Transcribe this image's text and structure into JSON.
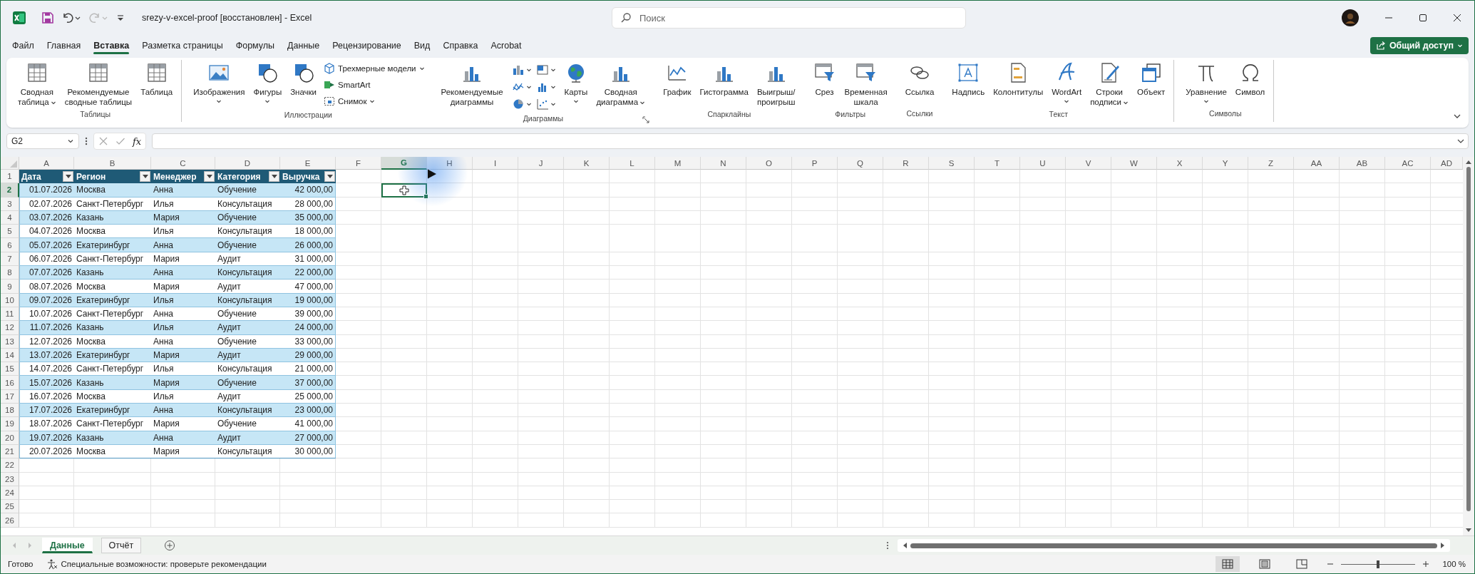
{
  "window": {
    "title": "srezy-v-excel-proof [восстановлен]  -  Excel",
    "search_placeholder": "Поиск"
  },
  "quick_access": [
    {
      "kind": "save",
      "disabled": false
    },
    {
      "kind": "undo",
      "disabled": false
    },
    {
      "kind": "redo",
      "disabled": true
    },
    {
      "kind": "customize",
      "disabled": false
    }
  ],
  "menu": {
    "tabs": [
      {
        "label": "Файл",
        "selected": false
      },
      {
        "label": "Главная",
        "selected": false
      },
      {
        "label": "Вставка",
        "selected": true
      },
      {
        "label": "Разметка страницы",
        "selected": false
      },
      {
        "label": "Формулы",
        "selected": false
      },
      {
        "label": "Данные",
        "selected": false
      },
      {
        "label": "Рецензирование",
        "selected": false
      },
      {
        "label": "Вид",
        "selected": false
      },
      {
        "label": "Справка",
        "selected": false
      },
      {
        "label": "Acrobat",
        "selected": false
      }
    ],
    "share_button": "Общий доступ"
  },
  "ribbon": {
    "groups": [
      {
        "label": "Таблицы",
        "launcher": false,
        "separator": true,
        "items": [
          {
            "kind": "large",
            "label": "Сводная\nтаблица",
            "menu": true
          },
          {
            "kind": "large",
            "label": "Рекомендуемые\nсводные таблицы",
            "menu": false
          },
          {
            "kind": "large",
            "label": "Таблица",
            "menu": false
          }
        ]
      },
      {
        "label": "Иллюстрации",
        "launcher": false,
        "separator": false,
        "items": [
          {
            "kind": "large",
            "label": "Изображения",
            "menu": true
          },
          {
            "kind": "large",
            "label": "Фигуры",
            "menu": true
          },
          {
            "kind": "large",
            "label": "Значки",
            "menu": false
          },
          {
            "kind": "stack",
            "entries": [
              {
                "label": "Трехмерные модели",
                "menu": true
              },
              {
                "label": "SmartArt",
                "menu": false
              },
              {
                "label": "Снимок",
                "menu": true
              }
            ]
          }
        ]
      },
      {
        "label": "Диаграммы",
        "launcher": true,
        "separator": false,
        "items": [
          {
            "kind": "large",
            "label": "Рекомендуемые\nдиаграммы",
            "menu": false
          },
          {
            "kind": "chart-grid"
          },
          {
            "kind": "large",
            "label": "Карты",
            "menu": true
          },
          {
            "kind": "large",
            "label": "Сводная\nдиаграмма",
            "menu": true
          }
        ]
      },
      {
        "label": "Спарклайны",
        "launcher": false,
        "separator": false,
        "items": [
          {
            "kind": "large",
            "label": "График",
            "menu": false
          },
          {
            "kind": "large",
            "label": "Гистограмма",
            "menu": false
          },
          {
            "kind": "large",
            "label": "Выигрыш/\nпроигрыш",
            "menu": false
          }
        ]
      },
      {
        "label": "Фильтры",
        "launcher": false,
        "separator": false,
        "items": [
          {
            "kind": "large",
            "label": "Срез",
            "menu": false
          },
          {
            "kind": "large",
            "label": "Временная\nшкала",
            "menu": false
          }
        ]
      },
      {
        "label": "Ссылки",
        "launcher": false,
        "separator": false,
        "items": [
          {
            "kind": "large",
            "label": "Ссылка",
            "menu": false
          }
        ]
      },
      {
        "label": "Текст",
        "launcher": false,
        "separator": true,
        "items": [
          {
            "kind": "large",
            "label": "Надпись",
            "menu": false
          },
          {
            "kind": "large",
            "label": "Колонтитулы",
            "menu": false
          },
          {
            "kind": "large",
            "label": "WordArt",
            "menu": true
          },
          {
            "kind": "large",
            "label": "Строки\nподписи",
            "menu": true
          },
          {
            "kind": "large",
            "label": "Объект",
            "menu": false
          }
        ]
      },
      {
        "label": "Символы",
        "launcher": false,
        "separator": true,
        "items": [
          {
            "kind": "large",
            "label": "Уравнение",
            "menu": true
          },
          {
            "kind": "large",
            "label": "Символ",
            "menu": false
          }
        ]
      }
    ]
  },
  "formula_bar": {
    "name_box": "G2",
    "function_label": "fx"
  },
  "sheet": {
    "columns": [
      {
        "label": "A",
        "selected": false
      },
      {
        "label": "B",
        "selected": false
      },
      {
        "label": "C",
        "selected": false
      },
      {
        "label": "D",
        "selected": false
      },
      {
        "label": "E",
        "selected": false
      },
      {
        "label": "F",
        "selected": false
      },
      {
        "label": "G",
        "selected": true
      },
      {
        "label": "H",
        "selected": false
      },
      {
        "label": "I",
        "selected": false
      },
      {
        "label": "J",
        "selected": false
      },
      {
        "label": "K",
        "selected": false
      },
      {
        "label": "L",
        "selected": false
      },
      {
        "label": "M",
        "selected": false
      },
      {
        "label": "N",
        "selected": false
      },
      {
        "label": "O",
        "selected": false
      },
      {
        "label": "P",
        "selected": false
      },
      {
        "label": "Q",
        "selected": false
      },
      {
        "label": "R",
        "selected": false
      },
      {
        "label": "S",
        "selected": false
      },
      {
        "label": "T",
        "selected": false
      },
      {
        "label": "U",
        "selected": false
      },
      {
        "label": "V",
        "selected": false
      },
      {
        "label": "W",
        "selected": false
      },
      {
        "label": "X",
        "selected": false
      },
      {
        "label": "Y",
        "selected": false
      },
      {
        "label": "Z",
        "selected": false
      },
      {
        "label": "AA",
        "selected": false
      },
      {
        "label": "AB",
        "selected": false
      },
      {
        "label": "AC",
        "selected": false
      },
      {
        "label": "AD",
        "selected": false
      }
    ],
    "rows": [
      {
        "label": "1",
        "selected": false
      },
      {
        "label": "2",
        "selected": true
      },
      {
        "label": "3",
        "selected": false
      },
      {
        "label": "4",
        "selected": false
      },
      {
        "label": "5",
        "selected": false
      },
      {
        "label": "6",
        "selected": false
      },
      {
        "label": "7",
        "selected": false
      },
      {
        "label": "8",
        "selected": false
      },
      {
        "label": "9",
        "selected": false
      },
      {
        "label": "10",
        "selected": false
      },
      {
        "label": "11",
        "selected": false
      },
      {
        "label": "12",
        "selected": false
      },
      {
        "label": "13",
        "selected": false
      },
      {
        "label": "14",
        "selected": false
      },
      {
        "label": "15",
        "selected": false
      },
      {
        "label": "16",
        "selected": false
      },
      {
        "label": "17",
        "selected": false
      },
      {
        "label": "18",
        "selected": false
      },
      {
        "label": "19",
        "selected": false
      },
      {
        "label": "20",
        "selected": false
      },
      {
        "label": "21",
        "selected": false
      },
      {
        "label": "22",
        "selected": false
      },
      {
        "label": "23",
        "selected": false
      },
      {
        "label": "24",
        "selected": false
      },
      {
        "label": "25",
        "selected": false
      },
      {
        "label": "26",
        "selected": false
      }
    ],
    "table": {
      "headers": [
        {
          "label": "Дата"
        },
        {
          "label": "Регион"
        },
        {
          "label": "Менеджер"
        },
        {
          "label": "Категория"
        },
        {
          "label": "Выручка"
        }
      ],
      "rows": [
        [
          "01.07.2026",
          "Москва",
          "Анна",
          "Обучение",
          "42 000,00"
        ],
        [
          "02.07.2026",
          "Санкт-Петербург",
          "Илья",
          "Консультация",
          "28 000,00"
        ],
        [
          "03.07.2026",
          "Казань",
          "Мария",
          "Обучение",
          "35 000,00"
        ],
        [
          "04.07.2026",
          "Москва",
          "Илья",
          "Консультация",
          "18 000,00"
        ],
        [
          "05.07.2026",
          "Екатеринбург",
          "Анна",
          "Обучение",
          "26 000,00"
        ],
        [
          "06.07.2026",
          "Санкт-Петербург",
          "Мария",
          "Аудит",
          "31 000,00"
        ],
        [
          "07.07.2026",
          "Казань",
          "Анна",
          "Консультация",
          "22 000,00"
        ],
        [
          "08.07.2026",
          "Москва",
          "Мария",
          "Аудит",
          "47 000,00"
        ],
        [
          "09.07.2026",
          "Екатеринбург",
          "Илья",
          "Консультация",
          "19 000,00"
        ],
        [
          "10.07.2026",
          "Санкт-Петербург",
          "Анна",
          "Обучение",
          "39 000,00"
        ],
        [
          "11.07.2026",
          "Казань",
          "Илья",
          "Аудит",
          "24 000,00"
        ],
        [
          "12.07.2026",
          "Москва",
          "Анна",
          "Обучение",
          "33 000,00"
        ],
        [
          "13.07.2026",
          "Екатеринбург",
          "Мария",
          "Аудит",
          "29 000,00"
        ],
        [
          "14.07.2026",
          "Санкт-Петербург",
          "Илья",
          "Консультация",
          "21 000,00"
        ],
        [
          "15.07.2026",
          "Казань",
          "Мария",
          "Обучение",
          "37 000,00"
        ],
        [
          "16.07.2026",
          "Москва",
          "Илья",
          "Аудит",
          "25 000,00"
        ],
        [
          "17.07.2026",
          "Екатеринбург",
          "Анна",
          "Консультация",
          "23 000,00"
        ],
        [
          "18.07.2026",
          "Санкт-Петербург",
          "Мария",
          "Обучение",
          "41 000,00"
        ],
        [
          "19.07.2026",
          "Казань",
          "Анна",
          "Аудит",
          "27 000,00"
        ],
        [
          "20.07.2026",
          "Москва",
          "Мария",
          "Консультация",
          "30 000,00"
        ]
      ]
    }
  },
  "sheet_tabs": [
    {
      "label": "Данные",
      "selected": true
    },
    {
      "label": "Отчёт",
      "selected": false
    }
  ],
  "status_bar": {
    "mode": "Готово",
    "accessibility": "Специальные возможности: проверьте рекомендации",
    "views": [
      {
        "kind": "normal",
        "selected": true
      },
      {
        "kind": "page-layout",
        "selected": false
      },
      {
        "kind": "page-break",
        "selected": false
      }
    ],
    "zoom": {
      "level": 0.5,
      "reading": "100 %"
    }
  }
}
